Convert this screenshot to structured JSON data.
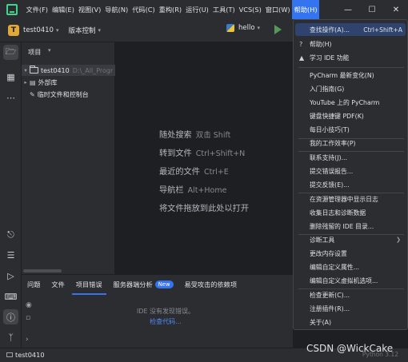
{
  "menubar": {
    "items": [
      "文件(F)",
      "编辑(E)",
      "视图(V)",
      "导航(N)",
      "代码(C)",
      "重构(R)",
      "运行(U)",
      "工具(T)",
      "VCS(S)",
      "窗口(W)",
      "帮助(H)"
    ]
  },
  "toolbar": {
    "project_initial": "T",
    "project_name": "test0410",
    "vcs_label": "版本控制",
    "run_config": "hello"
  },
  "project_panel": {
    "title": "项目",
    "tree": [
      {
        "label": "test0410",
        "path": "D:\\_All_Progr"
      },
      {
        "label": "外部库"
      },
      {
        "label": "临时文件和控制台"
      }
    ]
  },
  "editor": {
    "hints": [
      {
        "label": "随处搜索",
        "key": "双击 Shift"
      },
      {
        "label": "转到文件",
        "key": "Ctrl+Shift+N"
      },
      {
        "label": "最近的文件",
        "key": "Ctrl+E"
      },
      {
        "label": "导航栏",
        "key": "Alt+Home"
      },
      {
        "label": "将文件拖放到此处以打开",
        "key": ""
      }
    ]
  },
  "bottom_panel": {
    "tabs": [
      "问题",
      "文件",
      "项目错误",
      "服务器端分析",
      "易受攻击的依赖项"
    ],
    "new_badge": "New",
    "active_tab": "项目错误",
    "empty_message": "IDE 没有发现错误。",
    "check_link": "检查代码..."
  },
  "status_bar": {
    "project": "test0410",
    "python_version": "Python 3.12"
  },
  "help_menu": {
    "items": [
      {
        "label": "查找操作(A)...",
        "shortcut": "Ctrl+Shift+A"
      },
      {
        "label": "帮助(H)"
      },
      {
        "label": "学习 IDE 功能"
      },
      {
        "label": "PyCharm 最新变化(N)"
      },
      {
        "label": "入门指南(G)"
      },
      {
        "label": "YouTube 上的 PyCharm"
      },
      {
        "label": "键盘快捷键 PDF(K)"
      },
      {
        "label": "每日小技巧(T)"
      },
      {
        "label": "我的工作效率(P)"
      },
      {
        "label": "联系支持(J)..."
      },
      {
        "label": "提交错误报告..."
      },
      {
        "label": "提交反馈(E)..."
      },
      {
        "label": "在资源管理器中显示日志"
      },
      {
        "label": "收集日志和诊断数据"
      },
      {
        "label": "删除残留的 IDE 目录..."
      },
      {
        "label": "诊断工具"
      },
      {
        "label": "更改内存设置"
      },
      {
        "label": "编辑自定义属性..."
      },
      {
        "label": "编辑自定义虚拟机选项..."
      },
      {
        "label": "检查更新(C)..."
      },
      {
        "label": "注册插件(R)..."
      },
      {
        "label": "关于(A)"
      }
    ]
  },
  "watermark": "CSDN @WickCake",
  "colors": {
    "accent": "#3574f0",
    "highlight": "#2e436e",
    "run_green": "#57965c",
    "project_badge": "#e0a838"
  }
}
